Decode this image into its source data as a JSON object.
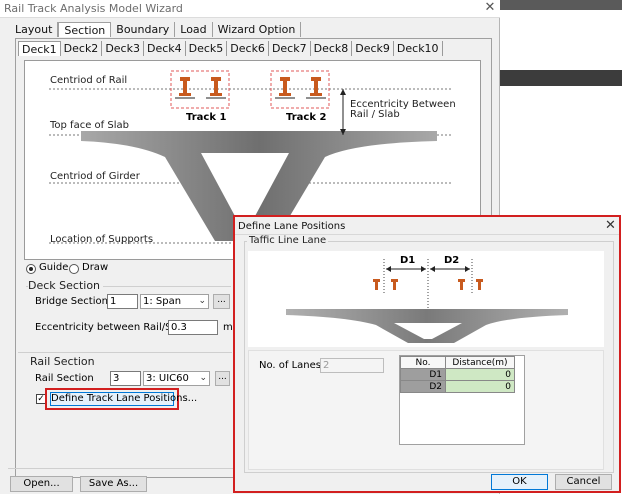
{
  "main_window": {
    "title": "Rail Track Analysis Model Wizard",
    "tabs": [
      "Layout",
      "Section",
      "Boundary",
      "Load",
      "Wizard Option"
    ],
    "active_tab": "Section",
    "deck_tabs": [
      "Deck1",
      "Deck2",
      "Deck3",
      "Deck4",
      "Deck5",
      "Deck6",
      "Deck7",
      "Deck8",
      "Deck9",
      "Deck10"
    ],
    "active_deck_tab": "Deck1",
    "diagram": {
      "centroid_of_rail": "Centriod of Rail",
      "top_face_of_slab": "Top face of Slab",
      "centroid_of_girder": "Centriod of Girder",
      "location_of_supports": "Location of Supports",
      "track1": "Track 1",
      "track2": "Track 2",
      "eccentricity_line1": "Eccentricity Between",
      "eccentricity_line2": "Rail / Slab"
    },
    "radio_guide": "Guide",
    "radio_draw": "Draw",
    "deck_section": {
      "label": "Deck Section",
      "bridge_section_label": "Bridge Section",
      "bridge_section_value": "1",
      "bridge_section_select": "1: Span",
      "more_button": "...",
      "eccentricity_label": "Eccentricity between Rail/Slab",
      "eccentricity_value": "0.3",
      "eccentricity_unit": "m"
    },
    "rail_section": {
      "label": "Rail Section",
      "rail_section_label": "Rail Section",
      "rail_section_value": "3",
      "rail_section_select": "3: UIC60",
      "more_button": "...",
      "define_button": "Define Track Lane Positions..."
    },
    "footer": {
      "open_button": "Open...",
      "save_as_button": "Save As..."
    }
  },
  "dialog": {
    "title": "Define Lane Positions",
    "group_label": "Taffic Line Lane",
    "d1_label": "D1",
    "d2_label": "D2",
    "no_of_lanes_label": "No. of Lanes",
    "no_of_lanes_value": "2",
    "table": {
      "headers": [
        "No.",
        "Distance(m)"
      ],
      "rows": [
        {
          "no": "D1",
          "distance": "0"
        },
        {
          "no": "D2",
          "distance": "0"
        }
      ]
    },
    "ok_button": "OK",
    "cancel_button": "Cancel"
  },
  "colors": {
    "highlight": "#d21f1f",
    "girder_gray": "#8a8a8a",
    "rail_orange": "#c85a1e",
    "cell_green": "#cfe8c4",
    "row_header_gray": "#9e9e9e"
  }
}
